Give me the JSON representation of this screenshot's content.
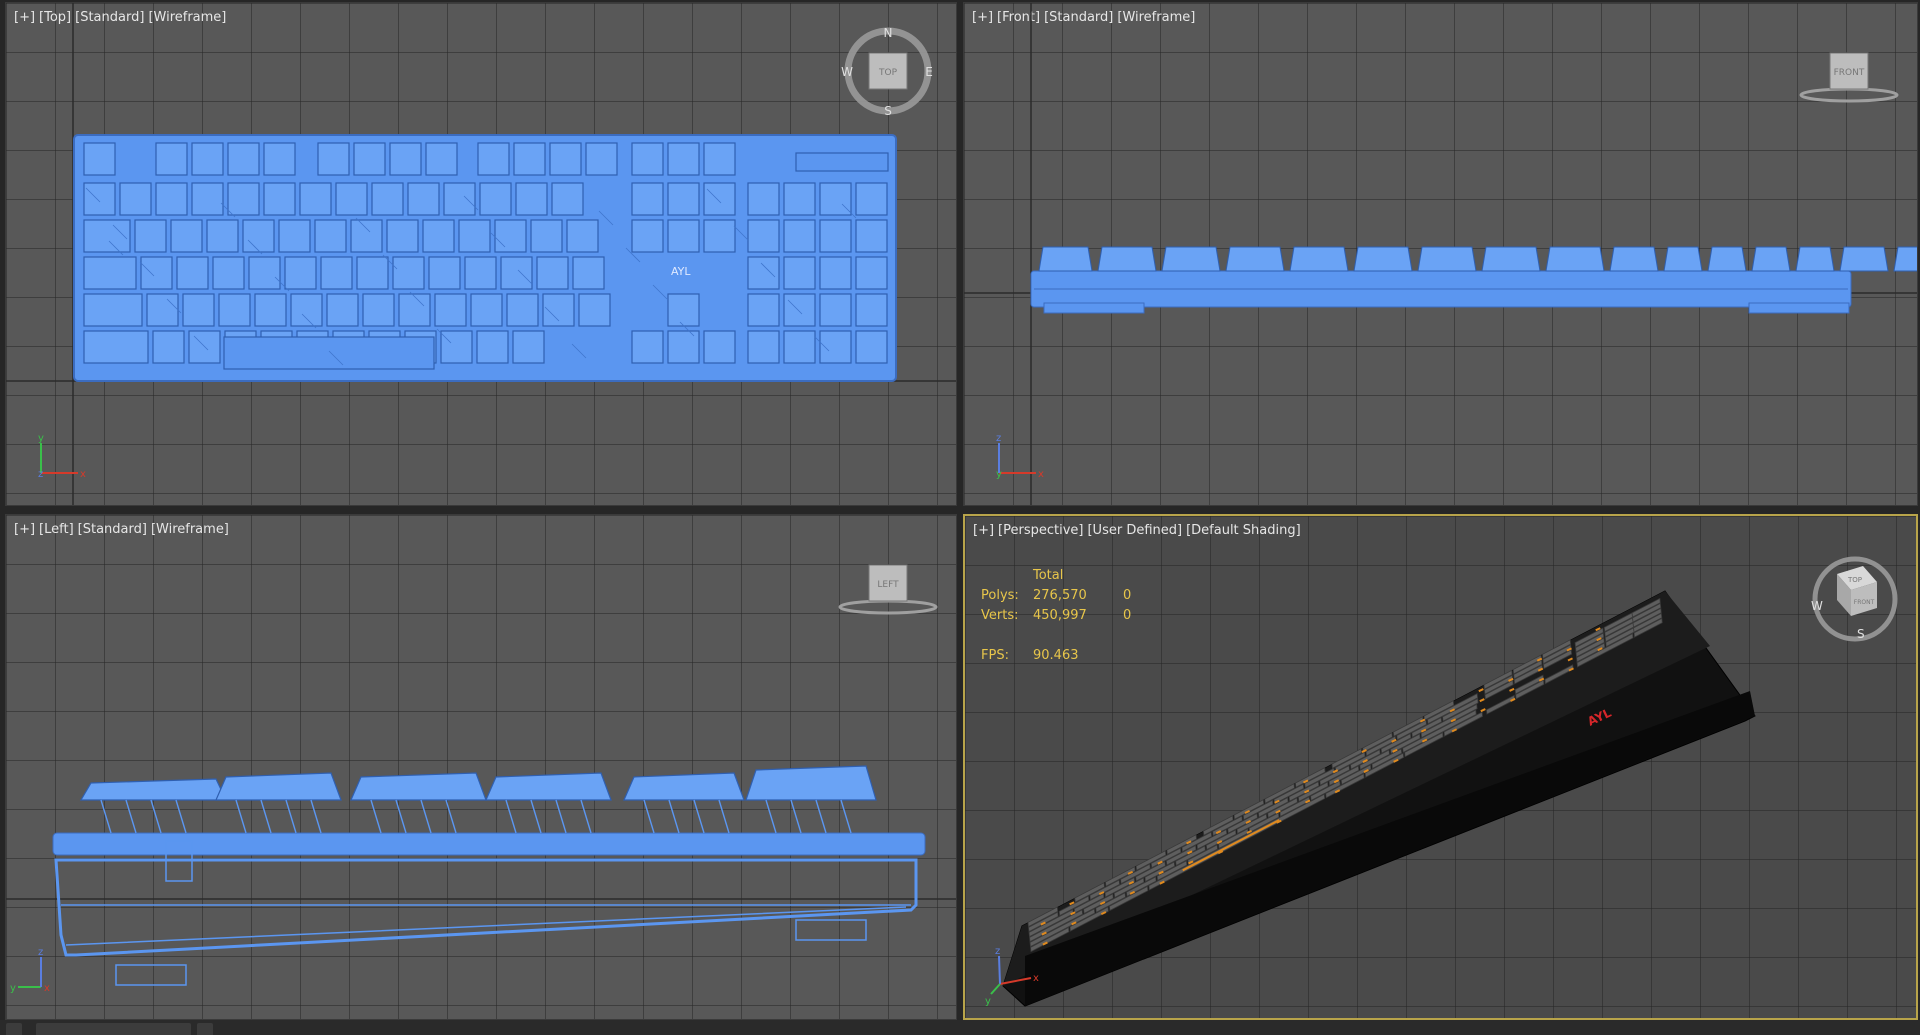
{
  "viewports": {
    "top": {
      "labels": [
        "[+]",
        "[Top]",
        "[Standard]",
        "[Wireframe]"
      ],
      "cube_label": "TOP",
      "compass": {
        "n": "N",
        "s": "S",
        "e": "E",
        "w": "W"
      },
      "model_text": "AYL"
    },
    "front": {
      "labels": [
        "[+]",
        "[Front]",
        "[Standard]",
        "[Wireframe]"
      ],
      "cube_label": "FRONT"
    },
    "left": {
      "labels": [
        "[+]",
        "[Left]",
        "[Standard]",
        "[Wireframe]"
      ],
      "cube_label": "LEFT"
    },
    "perspective": {
      "labels": [
        "[+]",
        "[Perspective]",
        "[User Defined]",
        "[Default Shading]"
      ],
      "cube_label": "TOP",
      "cube_label_front": "FRONT",
      "compass": {
        "w": "W",
        "s": "S"
      },
      "stats": {
        "header": "Total",
        "polys_label": "Polys:",
        "polys_total": "276,570",
        "polys_sel": "0",
        "verts_label": "Verts:",
        "verts_total": "450,997",
        "verts_sel": "0",
        "fps_label": "FPS:",
        "fps_value": "90.463"
      },
      "brand": "AYL"
    }
  },
  "axis": {
    "x": "x",
    "y": "y",
    "z": "z"
  },
  "colors": {
    "wire": "#5b96f0",
    "wire_dark": "#3b6cc0",
    "viewport_bg": "#585858",
    "active_border": "#b8a44a",
    "stats_text": "#e8c64a",
    "key_legend": "#e08a1e",
    "brand_red": "#d6262a"
  }
}
